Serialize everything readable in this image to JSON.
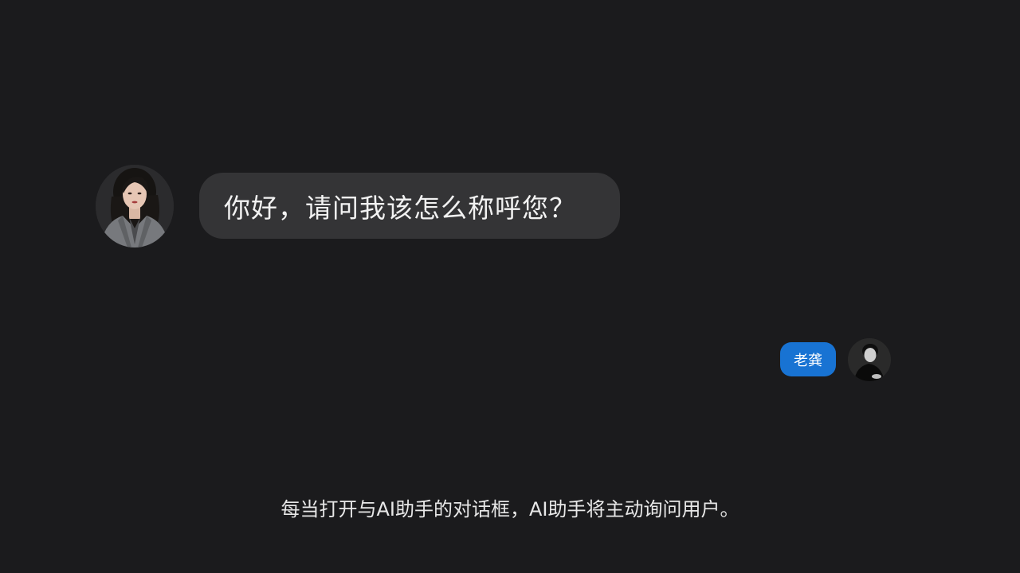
{
  "chat": {
    "assistant_message": "你好，请问我该怎么称呼您？",
    "user_reply": "老龚"
  },
  "caption": "每当打开与AI助手的对话框，AI助手将主动询问用户。",
  "avatars": {
    "assistant": "woman-portrait-avatar",
    "user": "man-portrait-avatar"
  },
  "colors": {
    "background": "#1b1b1d",
    "assistant_bubble": "#343436",
    "user_bubble": "#1873d3",
    "text": "#f2f2f2"
  }
}
